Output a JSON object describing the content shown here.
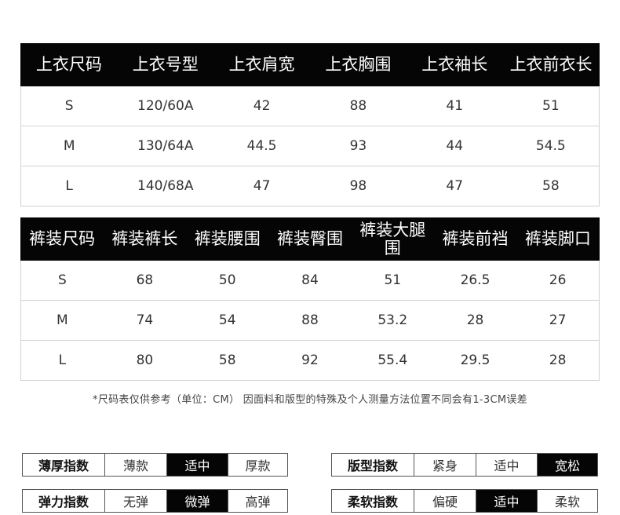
{
  "top_table": {
    "headers": [
      "上衣尺码",
      "上衣号型",
      "上衣肩宽",
      "上衣胸围",
      "上衣袖长",
      "上衣前衣长"
    ],
    "rows": [
      [
        "S",
        "120/60A",
        "42",
        "88",
        "41",
        "51"
      ],
      [
        "M",
        "130/64A",
        "44.5",
        "93",
        "44",
        "54.5"
      ],
      [
        "L",
        "140/68A",
        "47",
        "98",
        "47",
        "58"
      ]
    ]
  },
  "pants_table": {
    "headers": [
      "裤装尺码",
      "裤装裤长",
      "裤装腰围",
      "裤装臀围",
      "裤装大腿围",
      "裤装前裆",
      "裤装脚口"
    ],
    "rows": [
      [
        "S",
        "68",
        "50",
        "84",
        "51",
        "26.5",
        "26"
      ],
      [
        "M",
        "74",
        "54",
        "88",
        "53.2",
        "28",
        "27"
      ],
      [
        "L",
        "80",
        "58",
        "92",
        "55.4",
        "29.5",
        "28"
      ]
    ]
  },
  "note": "*尺码表仅供参考（单位：CM） 因面料和版型的特殊及个人测量方法位置不同会有1-3CM误差",
  "indices": {
    "thickness": {
      "label": "薄厚指数",
      "options": [
        "薄款",
        "适中",
        "厚款"
      ],
      "selected": "适中"
    },
    "fit": {
      "label": "版型指数",
      "options": [
        "紧身",
        "适中",
        "宽松"
      ],
      "selected": "宽松"
    },
    "elastic": {
      "label": "弹力指数",
      "options": [
        "无弹",
        "微弹",
        "高弹"
      ],
      "selected": "微弹"
    },
    "soft": {
      "label": "柔软指数",
      "options": [
        "偏硬",
        "适中",
        "柔软"
      ],
      "selected": "适中"
    }
  }
}
